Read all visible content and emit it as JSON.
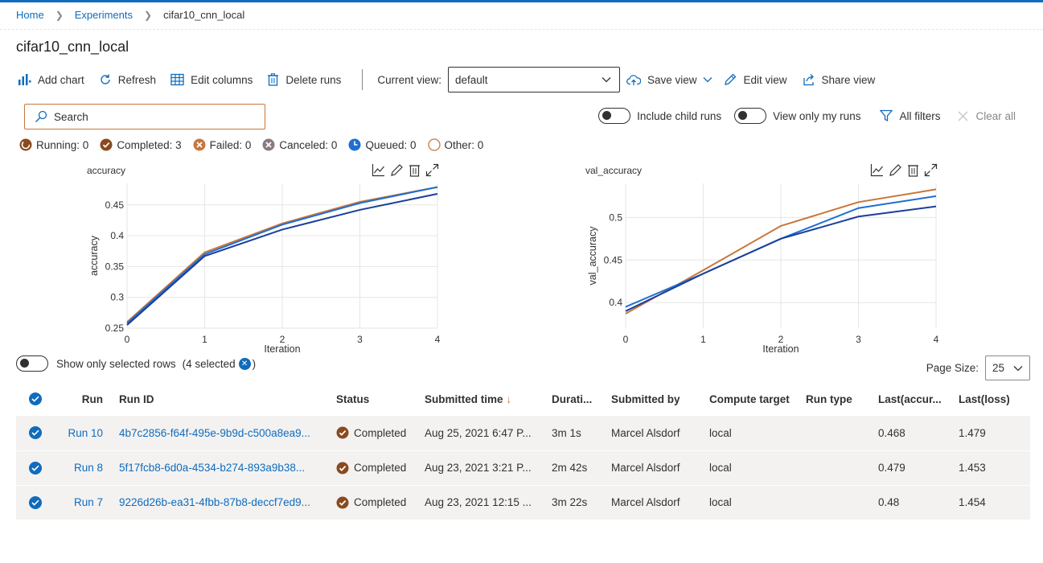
{
  "breadcrumb": {
    "home": "Home",
    "experiments": "Experiments",
    "current": "cifar10_cnn_local"
  },
  "page_title": "cifar10_cnn_local",
  "toolbar": {
    "add_chart": "Add chart",
    "refresh": "Refresh",
    "edit_columns": "Edit columns",
    "delete_runs": "Delete runs",
    "current_view_label": "Current view:",
    "current_view_value": "default",
    "save_view": "Save view",
    "edit_view": "Edit view",
    "share_view": "Share view"
  },
  "search": {
    "placeholder": "Search"
  },
  "filters": {
    "include_child_runs": "Include child runs",
    "view_only_my_runs": "View only my runs",
    "all_filters": "All filters",
    "clear_all": "Clear all"
  },
  "status_counts": {
    "running": "Running: 0",
    "completed": "Completed: 3",
    "failed": "Failed: 0",
    "canceled": "Canceled: 0",
    "queued": "Queued: 0",
    "other": "Other: 0"
  },
  "colors": {
    "accent": "#0f6cbd",
    "run10": "#c8763a",
    "run8": "#1f6fd1",
    "run7": "#1a3f9a"
  },
  "chart_data": [
    {
      "type": "line",
      "title": "accuracy",
      "xlabel": "Iteration",
      "ylabel": "accuracy",
      "x": [
        0,
        1,
        2,
        3,
        4
      ],
      "xlim": [
        0,
        4
      ],
      "ylim": [
        0.25,
        0.485
      ],
      "yticks": [
        0.25,
        0.3,
        0.35,
        0.4,
        0.45
      ],
      "ytick_labels": [
        "0.25",
        "0.3",
        "0.35",
        "0.4",
        "0.45"
      ],
      "xtick_labels": [
        "0",
        "1",
        "2",
        "3",
        "4"
      ],
      "series": [
        {
          "values": [
            0.26,
            0.373,
            0.42,
            0.455,
            0.479
          ],
          "color": "#c8763a"
        },
        {
          "values": [
            0.258,
            0.37,
            0.418,
            0.453,
            0.479
          ],
          "color": "#1f6fd1"
        },
        {
          "values": [
            0.255,
            0.367,
            0.41,
            0.442,
            0.468
          ],
          "color": "#1a3f9a"
        }
      ]
    },
    {
      "type": "line",
      "title": "val_accuracy",
      "xlabel": "Iteration",
      "ylabel": "val_accuracy",
      "x": [
        0,
        1,
        2,
        3,
        4
      ],
      "xlim": [
        0,
        4
      ],
      "ylim": [
        0.37,
        0.54
      ],
      "yticks": [
        0.4,
        0.45,
        0.5
      ],
      "ytick_labels": [
        "0.4",
        "0.45",
        "0.5"
      ],
      "xtick_labels": [
        "0",
        "1",
        "2",
        "3",
        "4"
      ],
      "series": [
        {
          "values": [
            0.387,
            0.438,
            0.49,
            0.518,
            0.533
          ],
          "color": "#c8763a"
        },
        {
          "values": [
            0.395,
            0.434,
            0.475,
            0.511,
            0.525
          ],
          "color": "#1f6fd1"
        },
        {
          "values": [
            0.39,
            0.434,
            0.475,
            0.501,
            0.513
          ],
          "color": "#1a3f9a"
        }
      ]
    }
  ],
  "rows_toggle": {
    "label": "Show only selected rows",
    "selected": "(4 selected",
    "close": ")"
  },
  "page_size": {
    "label": "Page Size:",
    "value": "25"
  },
  "table": {
    "headers": [
      "Run",
      "Run ID",
      "Status",
      "Submitted time",
      "Durati...",
      "Submitted by",
      "Compute target",
      "Run type",
      "Last(accur...",
      "Last(loss)"
    ],
    "sort_arrow": "↓",
    "rows": [
      {
        "run": "Run 10",
        "run_id": "4b7c2856-f64f-495e-9b9d-c500a8ea9...",
        "status": "Completed",
        "submitted": "Aug 25, 2021 6:47 P...",
        "duration": "3m 1s",
        "by": "Marcel Alsdorf",
        "target": "local",
        "type": "",
        "acc": "0.468",
        "loss": "1.479"
      },
      {
        "run": "Run 8",
        "run_id": "5f17fcb8-6d0a-4534-b274-893a9b38...",
        "status": "Completed",
        "submitted": "Aug 23, 2021 3:21 P...",
        "duration": "2m 42s",
        "by": "Marcel Alsdorf",
        "target": "local",
        "type": "",
        "acc": "0.479",
        "loss": "1.453"
      },
      {
        "run": "Run 7",
        "run_id": "9226d26b-ea31-4fbb-87b8-deccf7ed9...",
        "status": "Completed",
        "submitted": "Aug 23, 2021 12:15 ...",
        "duration": "3m 22s",
        "by": "Marcel Alsdorf",
        "target": "local",
        "type": "",
        "acc": "0.48",
        "loss": "1.454"
      }
    ]
  }
}
